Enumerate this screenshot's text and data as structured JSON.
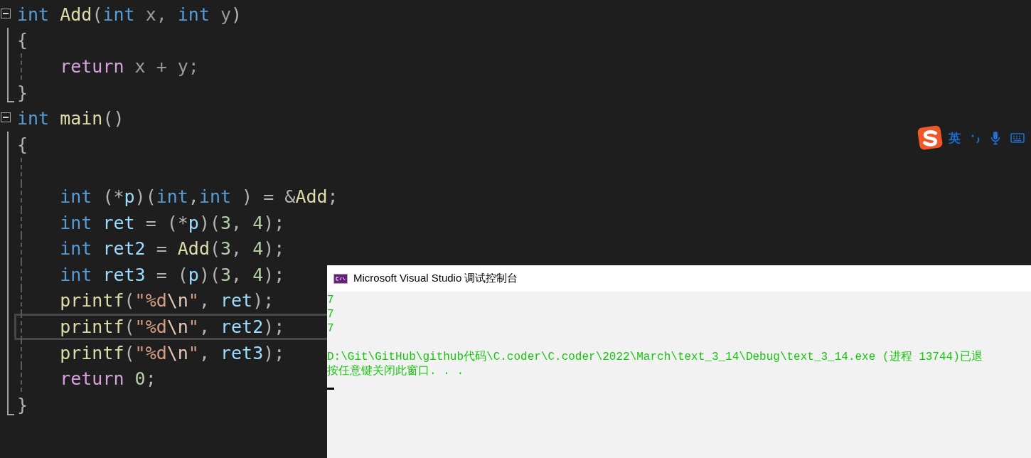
{
  "editor": {
    "lines": [
      {
        "fold_expanded": true,
        "tokens": [
          {
            "kind": "kw",
            "text": "int"
          },
          {
            "kind": "fn",
            "text": " Add"
          },
          {
            "kind": "punct",
            "text": "("
          },
          {
            "kind": "kw",
            "text": "int"
          },
          {
            "kind": "param",
            "text": " x, "
          },
          {
            "kind": "kw",
            "text": "int"
          },
          {
            "kind": "param",
            "text": " y"
          },
          {
            "kind": "punct",
            "text": ")"
          }
        ]
      },
      {
        "tokens": [
          {
            "kind": "punct",
            "text": "{"
          }
        ]
      },
      {
        "tokens": [
          {
            "kind": "ctrl",
            "text": "    return"
          },
          {
            "kind": "param",
            "text": " x + y;"
          }
        ]
      },
      {
        "fold_end": true,
        "tokens": [
          {
            "kind": "punct",
            "text": "}"
          }
        ]
      },
      {
        "fold_expanded": true,
        "tokens": [
          {
            "kind": "kw",
            "text": "int"
          },
          {
            "kind": "fn",
            "text": " main"
          },
          {
            "kind": "punct",
            "text": "()"
          }
        ]
      },
      {
        "tokens": [
          {
            "kind": "punct",
            "text": "{"
          }
        ]
      },
      {
        "gap_before": true,
        "tokens": [
          {
            "kind": "kw",
            "text": "    int"
          },
          {
            "kind": "punct",
            "text": " (*"
          },
          {
            "kind": "var",
            "text": "p"
          },
          {
            "kind": "punct",
            "text": ")("
          },
          {
            "kind": "kw",
            "text": "int"
          },
          {
            "kind": "punct",
            "text": ","
          },
          {
            "kind": "kw",
            "text": "int"
          },
          {
            "kind": "punct",
            "text": " ) = &"
          },
          {
            "kind": "fn",
            "text": "Add"
          },
          {
            "kind": "punct",
            "text": ";"
          }
        ]
      },
      {
        "tokens": [
          {
            "kind": "kw",
            "text": "    int"
          },
          {
            "kind": "var",
            "text": " ret"
          },
          {
            "kind": "punct",
            "text": " = (*"
          },
          {
            "kind": "var",
            "text": "p"
          },
          {
            "kind": "punct",
            "text": ")("
          },
          {
            "kind": "num",
            "text": "3"
          },
          {
            "kind": "punct",
            "text": ", "
          },
          {
            "kind": "num",
            "text": "4"
          },
          {
            "kind": "punct",
            "text": ");"
          }
        ]
      },
      {
        "tokens": [
          {
            "kind": "kw",
            "text": "    int"
          },
          {
            "kind": "var",
            "text": " ret2"
          },
          {
            "kind": "punct",
            "text": " = "
          },
          {
            "kind": "fn",
            "text": "Add"
          },
          {
            "kind": "punct",
            "text": "("
          },
          {
            "kind": "num",
            "text": "3"
          },
          {
            "kind": "punct",
            "text": ", "
          },
          {
            "kind": "num",
            "text": "4"
          },
          {
            "kind": "punct",
            "text": ");"
          }
        ]
      },
      {
        "tokens": [
          {
            "kind": "kw",
            "text": "    int"
          },
          {
            "kind": "var",
            "text": " ret3"
          },
          {
            "kind": "punct",
            "text": " = ("
          },
          {
            "kind": "var",
            "text": "p"
          },
          {
            "kind": "punct",
            "text": ")("
          },
          {
            "kind": "num",
            "text": "3"
          },
          {
            "kind": "punct",
            "text": ", "
          },
          {
            "kind": "num",
            "text": "4"
          },
          {
            "kind": "punct",
            "text": ");"
          }
        ]
      },
      {
        "tokens": [
          {
            "kind": "fn",
            "text": "    printf"
          },
          {
            "kind": "punct",
            "text": "("
          },
          {
            "kind": "str",
            "text": "\"%d"
          },
          {
            "kind": "esc",
            "text": "\\n"
          },
          {
            "kind": "str",
            "text": "\""
          },
          {
            "kind": "punct",
            "text": ", "
          },
          {
            "kind": "var",
            "text": "ret"
          },
          {
            "kind": "punct",
            "text": ");"
          }
        ]
      },
      {
        "current": true,
        "tokens": [
          {
            "kind": "fn",
            "text": "    printf"
          },
          {
            "kind": "punct",
            "text": "("
          },
          {
            "kind": "str",
            "text": "\"%d"
          },
          {
            "kind": "esc",
            "text": "\\n"
          },
          {
            "kind": "str",
            "text": "\""
          },
          {
            "kind": "punct",
            "text": ", "
          },
          {
            "kind": "var",
            "text": "ret2"
          },
          {
            "kind": "punct",
            "text": ");"
          }
        ]
      },
      {
        "tokens": [
          {
            "kind": "fn",
            "text": "    printf"
          },
          {
            "kind": "punct",
            "text": "("
          },
          {
            "kind": "str",
            "text": "\"%d"
          },
          {
            "kind": "esc",
            "text": "\\n"
          },
          {
            "kind": "str",
            "text": "\""
          },
          {
            "kind": "punct",
            "text": ", "
          },
          {
            "kind": "var",
            "text": "ret3"
          },
          {
            "kind": "punct",
            "text": ");"
          }
        ]
      },
      {
        "tokens": [
          {
            "kind": "ctrl",
            "text": "    return"
          },
          {
            "kind": "num",
            "text": " 0"
          },
          {
            "kind": "punct",
            "text": ";"
          }
        ]
      },
      {
        "fold_end": true,
        "tokens": [
          {
            "kind": "punct",
            "text": "}"
          }
        ]
      }
    ]
  },
  "ime_toolbar": {
    "mode": "英"
  },
  "console": {
    "title": "Microsoft Visual Studio 调试控制台",
    "cursor": true,
    "lines": [
      {
        "text": "7"
      },
      {
        "text": "7"
      },
      {
        "text": "7"
      },
      {
        "text": "D:\\Git\\GitHub\\github代码\\C.coder\\C.coder\\2022\\March\\text_3_14\\Debug\\text_3_14.exe (进程 13744)已退",
        "gap_before": true
      },
      {
        "text": "按任意键关闭此窗口. . ."
      }
    ]
  }
}
